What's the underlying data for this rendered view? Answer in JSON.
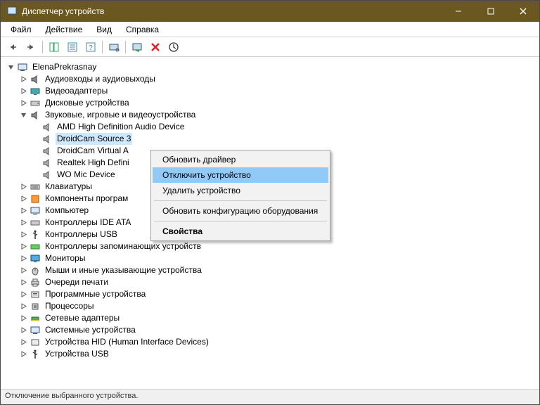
{
  "window": {
    "title": "Диспетчер устройств"
  },
  "menus": {
    "file": "Файл",
    "action": "Действие",
    "view": "Вид",
    "help": "Справка"
  },
  "tree": {
    "root": "ElenaPrekrasnay",
    "cat_audio_io": "Аудиовходы и аудиовыходы",
    "cat_video": "Видеоадаптеры",
    "cat_disk": "Дисковые устройства",
    "cat_sound": "Звуковые, игровые и видеоустройства",
    "snd_amd": "AMD High Definition Audio Device",
    "snd_droidcam3": "DroidCam Source 3",
    "snd_droidcam_va": "DroidCam Virtual A",
    "snd_realtek": "Realtek High Defini",
    "snd_womic": "WO Mic Device",
    "cat_keyboards": "Клавиатуры",
    "cat_sw_components": "Компоненты програм",
    "cat_computer": "Компьютер",
    "cat_ide": "Контроллеры IDE ATA",
    "cat_usb_ctrl": "Контроллеры USB",
    "cat_storage_ctrl": "Контроллеры запоминающих устройств",
    "cat_monitors": "Мониторы",
    "cat_mice": "Мыши и иные указывающие устройства",
    "cat_print_queues": "Очереди печати",
    "cat_sw_devices": "Программные устройства",
    "cat_cpu": "Процессоры",
    "cat_net": "Сетевые адаптеры",
    "cat_system": "Системные устройства",
    "cat_hid": "Устройства HID (Human Interface Devices)",
    "cat_usb_dev": "Устройства USB"
  },
  "context_menu": {
    "update_driver": "Обновить драйвер",
    "disable_device": "Отключить устройство",
    "uninstall_device": "Удалить устройство",
    "scan_hw": "Обновить конфигурацию оборудования",
    "properties": "Свойства"
  },
  "status": "Отключение выбранного устройства."
}
